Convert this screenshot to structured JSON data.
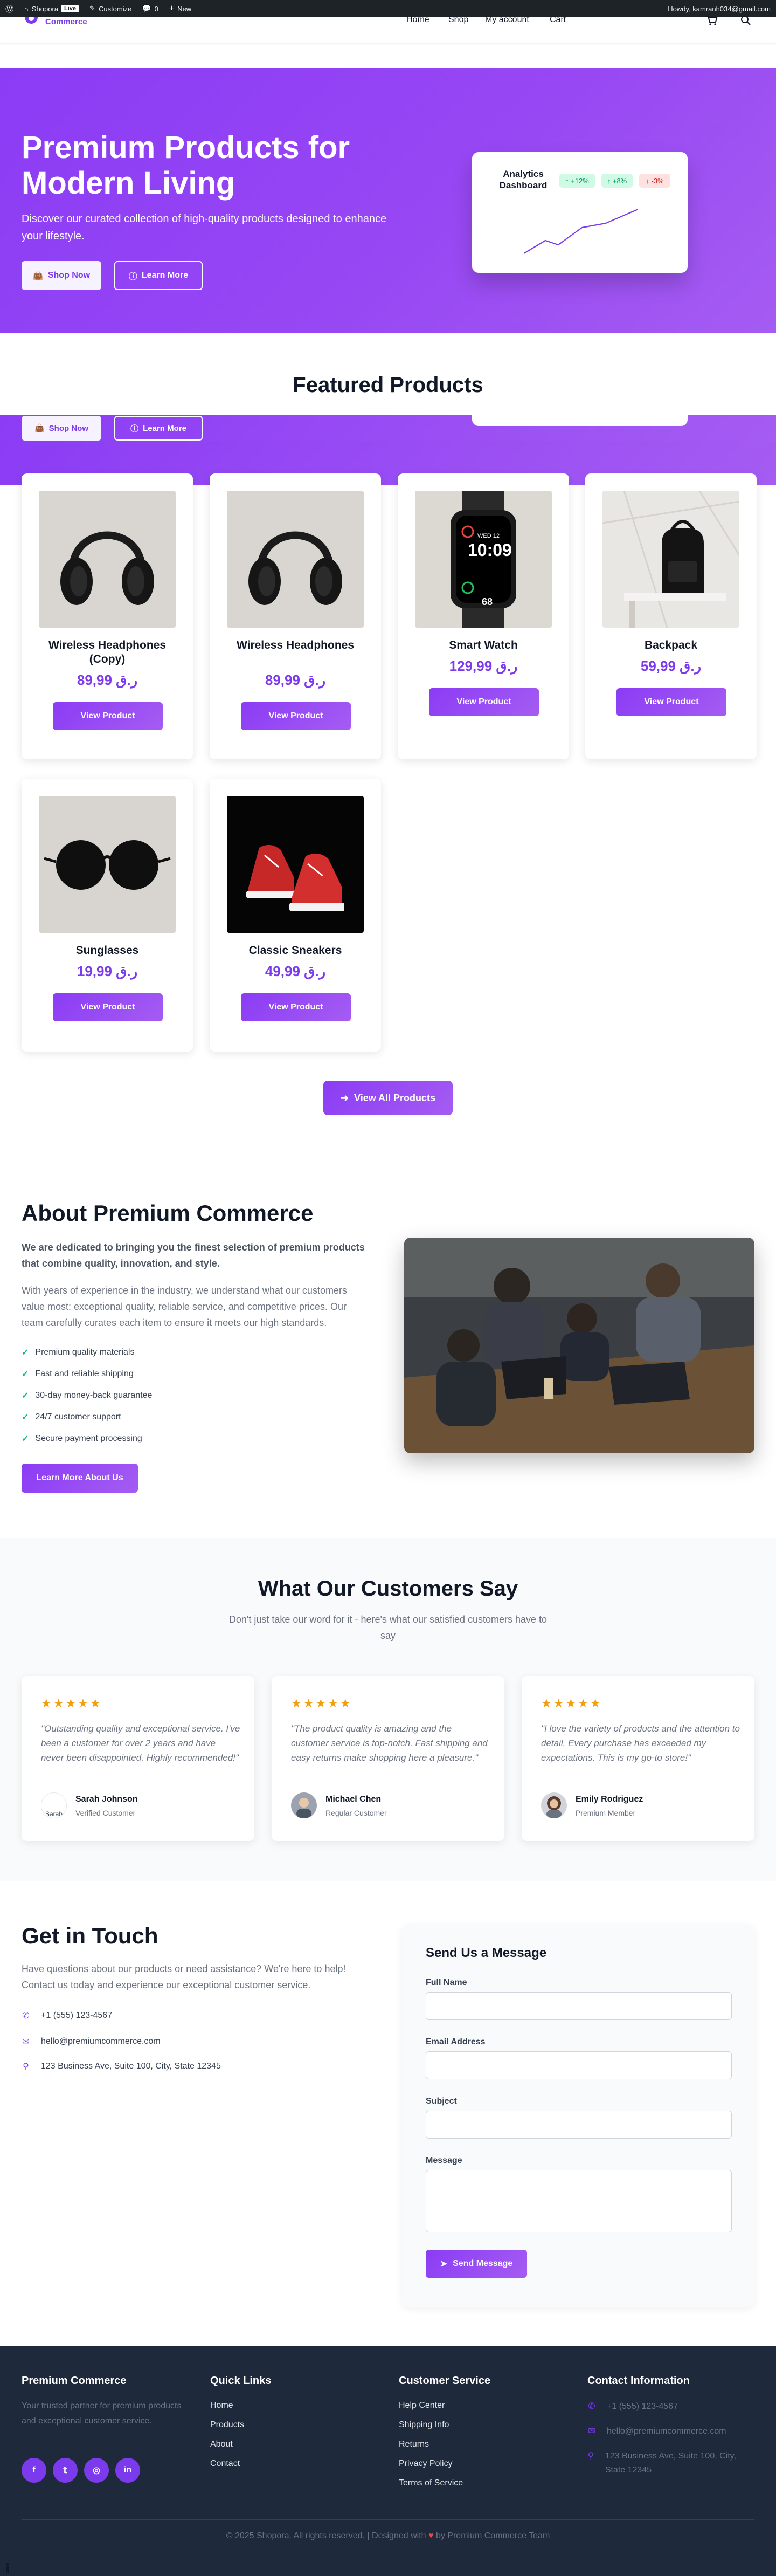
{
  "adminbar": {
    "site_name": "Shopora",
    "live_badge": "Live",
    "customize": "Customize",
    "comments_count": "0",
    "new_label": "New",
    "howdy": "Howdy, kamranh034@gmail.com"
  },
  "header": {
    "logo_text": "Commerce",
    "nav": [
      "Home",
      "Shop",
      "My account",
      "Cart"
    ],
    "icons": [
      "cart-icon",
      "search-icon"
    ]
  },
  "hero": {
    "title": "Premium Products for Modern Living",
    "subtitle": "Discover our curated collection of high-quality products designed to enhance your lifestyle.",
    "shop_now": "Shop Now",
    "learn_more": "Learn More",
    "dashboard": {
      "title": "Analytics Dashboard",
      "pills": [
        "↑ +12%",
        "↑ +8%",
        "↓ -3%"
      ]
    }
  },
  "featured": {
    "title": "Featured Products",
    "ghost_shop": "Shop Now",
    "ghost_learn": "Learn More",
    "view_all": "View All Products",
    "products": [
      {
        "name": "Wireless Headphones (Copy)",
        "price": "ر.ق 89,99",
        "button": "View Product",
        "image": "headphones"
      },
      {
        "name": "Wireless Headphones",
        "price": "ر.ق 89,99",
        "button": "View Product",
        "image": "headphones"
      },
      {
        "name": "Smart Watch",
        "price": "ر.ق 129,99",
        "button": "View Product",
        "image": "smartwatch"
      },
      {
        "name": "Backpack",
        "price": "ر.ق 59,99",
        "button": "View Product",
        "image": "backpack"
      },
      {
        "name": "Sunglasses",
        "price": "ر.ق 19,99",
        "button": "View Product",
        "image": "sunglasses"
      },
      {
        "name": "Classic Sneakers",
        "price": "ر.ق 49,99",
        "button": "View Product",
        "image": "sneakers"
      }
    ],
    "watch_face": {
      "date": "WED 12",
      "time": "10:09",
      "value": "68"
    }
  },
  "about": {
    "title": "About Premium Commerce",
    "lead": "We are dedicated to bringing you the finest selection of premium products that combine quality, innovation, and style.",
    "body": "With years of experience in the industry, we understand what our customers value most: exceptional quality, reliable service, and competitive prices. Our team carefully curates each item to ensure it meets our high standards.",
    "features": [
      "Premium quality materials",
      "Fast and reliable shipping",
      "30-day money-back guarantee",
      "24/7 customer support",
      "Secure payment processing"
    ],
    "button": "Learn More About Us"
  },
  "testimonials": {
    "title": "What Our Customers Say",
    "subtitle": "Don't just take our word for it - here's what our satisfied customers have to say",
    "items": [
      {
        "stars": "★★★★★",
        "quote": "\"Outstanding quality and exceptional service. I've been a customer for over 2 years and have never been disappointed. Highly recommended!\"",
        "name": "Sarah Johnson",
        "role": "Verified Customer",
        "avatar_alt": "Sarah"
      },
      {
        "stars": "★★★★★",
        "quote": "\"The product quality is amazing and the customer service is top-notch. Fast shipping and easy returns make shopping here a pleasure.\"",
        "name": "Michael Chen",
        "role": "Regular Customer"
      },
      {
        "stars": "★★★★★",
        "quote": "\"I love the variety of products and the attention to detail. Every purchase has exceeded my expectations. This is my go-to store!\"",
        "name": "Emily Rodriguez",
        "role": "Premium Member"
      }
    ]
  },
  "contact": {
    "title": "Get in Touch",
    "description": "Have questions about our products or need assistance? We're here to help! Contact us today and experience our exceptional customer service.",
    "phone": "+1 (555) 123-4567",
    "email": "hello@premiumcommerce.com",
    "address": "123 Business Ave, Suite 100, City, State 12345",
    "form": {
      "title": "Send Us a Message",
      "full_name": "Full Name",
      "email": "Email Address",
      "subject": "Subject",
      "message": "Message",
      "send": "Send Message"
    }
  },
  "footer": {
    "brand": "Premium Commerce",
    "brand_desc": "Your trusted partner for premium products and exceptional customer service.",
    "social": [
      "facebook-icon",
      "twitter-icon",
      "instagram-icon",
      "linkedin-icon"
    ],
    "quick_links_title": "Quick Links",
    "quick_links": [
      "Home",
      "Products",
      "About",
      "Contact"
    ],
    "service_title": "Customer Service",
    "service_links": [
      "Help Center",
      "Shipping Info",
      "Returns",
      "Privacy Policy",
      "Terms of Service"
    ],
    "contact_title": "Contact Information",
    "phone": "+1 (555) 123-4567",
    "email": "hello@premiumcommerce.com",
    "address": "123 Business Ave, Suite 100, City, State 12345",
    "copyright_pre": "© 2025 Shopora. All rights reserved. | Designed with",
    "copyright_post": "by Premium Commerce Team"
  },
  "colors": {
    "accent": "#7c3aed",
    "accent_light": "#a55cf2",
    "footer_bg": "#1e293b",
    "star": "#f59e0b",
    "check": "#10b981"
  }
}
